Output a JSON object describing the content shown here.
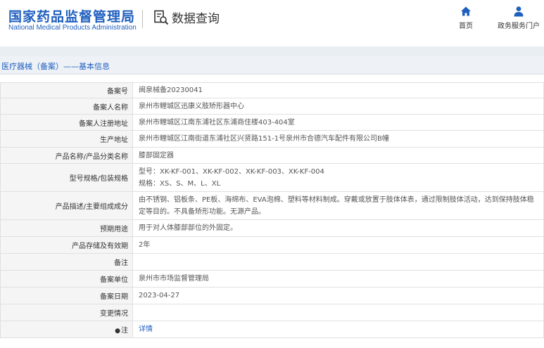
{
  "header": {
    "logo_cn": "国家药品监督管理局",
    "logo_en": "National Medical Products Administration",
    "query_label": "数据查询",
    "query_icon": "search-document-icon",
    "nav": {
      "home_label": "首页",
      "home_icon": "home-icon",
      "portal_label": "政务服务门户",
      "portal_icon": "user-icon"
    }
  },
  "breadcrumb": {
    "text": "医疗器械（备案）——基本信息"
  },
  "rows": {
    "filing_no": {
      "label": "备案号",
      "value": "闽泉械备20230041"
    },
    "filer_name": {
      "label": "备案人名称",
      "value": "泉州市鲤城区迅康义肢矫形器中心"
    },
    "filer_address": {
      "label": "备案人注册地址",
      "value": "泉州市鲤城区江南东浦社区东浦商住楼403-404室"
    },
    "production_address": {
      "label": "生产地址",
      "value": "泉州市鲤城区江南街道东浦社区兴贤路151-1号泉州市合德汽车配件有限公司B幢"
    },
    "product_name": {
      "label": "产品名称/产品分类名称",
      "value": "膝部固定器"
    },
    "model_spec": {
      "label": "型号规格/包装规格",
      "value_line1": "型号：XK-KF-001、XK-KF-002、XK-KF-003、XK-KF-004",
      "value_line2": "规格：XS、S、M、L、XL"
    },
    "description": {
      "label": "产品描述/主要组成成分",
      "value": "由不锈钢、铝板条、PE板、海绵布、EVA泡棉、塑料等材料制成。穿戴或放置于肢体体表，通过限制肢体活动，达到保持肢体稳定等目的。不具备矫形功能。无源产品。"
    },
    "intended_use": {
      "label": "预期用途",
      "value": "用于对人体膝部部位的外固定。"
    },
    "storage": {
      "label": "产品存储及有效期",
      "value": "2年"
    },
    "remarks": {
      "label": "备注",
      "value": ""
    },
    "filing_unit": {
      "label": "备案单位",
      "value": "泉州市市场监督管理局"
    },
    "filing_date": {
      "label": "备案日期",
      "value": "2023-04-27"
    },
    "change_status": {
      "label": "变更情况",
      "value": ""
    },
    "note": {
      "label": "注",
      "icon": "pin-icon",
      "value": "详情"
    }
  },
  "colors": {
    "brand_blue": "#1f5fbf",
    "label_bg": "#f5f5f5",
    "strip_bg": "#e9eef3"
  }
}
